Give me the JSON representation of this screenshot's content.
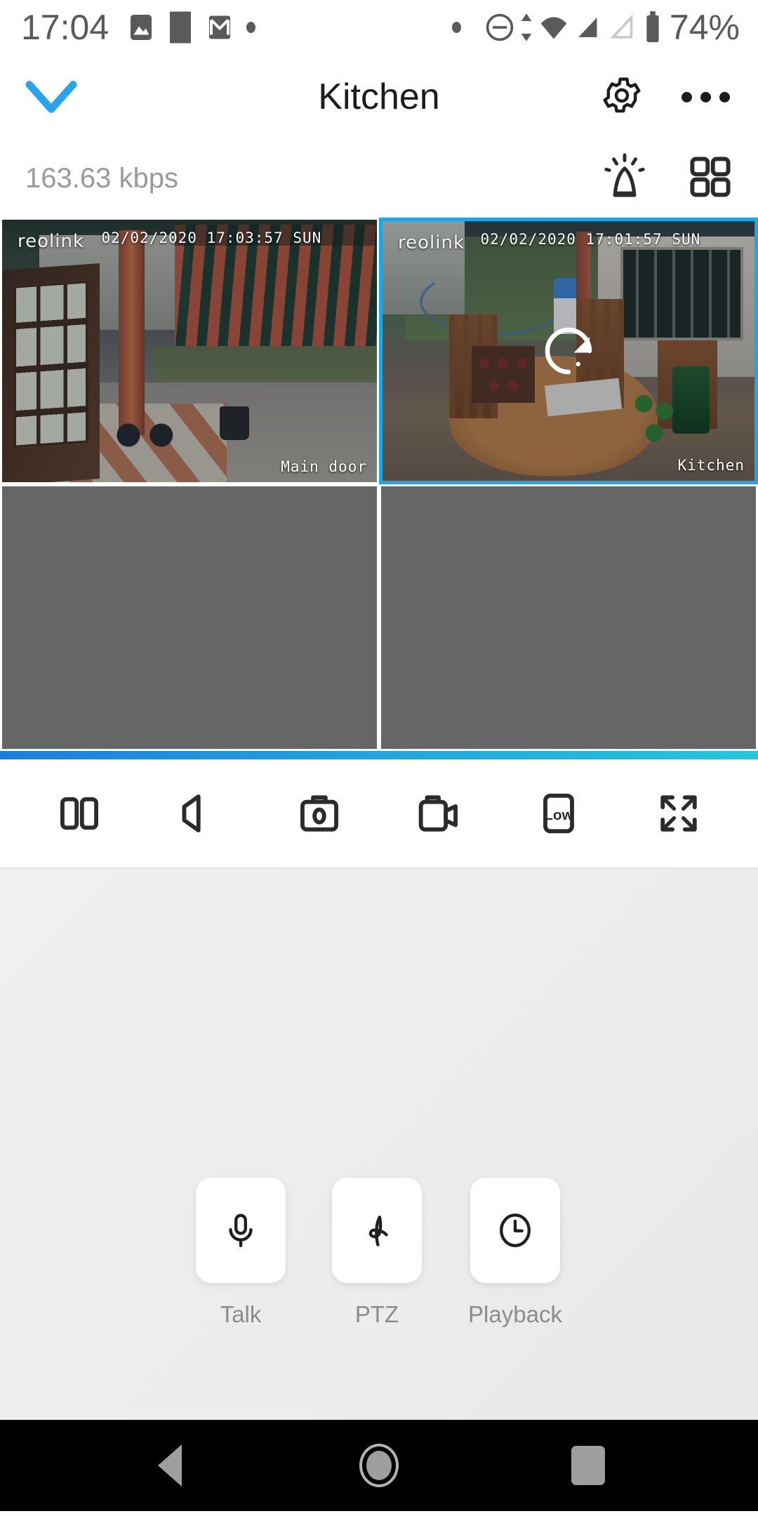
{
  "status_bar": {
    "clock": "17:04",
    "battery_percent": "74%",
    "icons": [
      "image-icon",
      "square-app-icon",
      "gmail-icon",
      "dot-icon",
      "dot-icon",
      "do-not-disturb-icon",
      "wifi-icon",
      "signal-no-sim-icon",
      "signal-empty-icon",
      "battery-icon"
    ]
  },
  "header": {
    "title": "Kitchen",
    "back_icon": "chevron-down-icon",
    "settings_icon": "gear-icon",
    "overflow_icon": "more-options-icon",
    "accent_color": "#1b9ae8"
  },
  "info_bar": {
    "bitrate": "163.63 kbps",
    "siren_icon": "siren-alarm-icon",
    "layout_icon": "grid-layout-icon"
  },
  "video_grid": {
    "brand": "reolink",
    "cells": [
      {
        "name": "Main door",
        "timestamp": "02/02/2020 17:03:57 SUN",
        "state": "live",
        "selected": false,
        "loading": false
      },
      {
        "name": "Kitchen",
        "timestamp": "02/02/2020 17:01:57 SUN",
        "state": "live",
        "selected": true,
        "loading": true
      },
      {
        "name": "",
        "timestamp": "",
        "state": "empty",
        "selected": false,
        "loading": false
      },
      {
        "name": "",
        "timestamp": "",
        "state": "empty",
        "selected": false,
        "loading": false
      }
    ],
    "selection_color": "#18a8e8",
    "empty_color": "#666666"
  },
  "toolbar": {
    "items": [
      {
        "label": "",
        "icon": "pause-icon"
      },
      {
        "label": "",
        "icon": "speaker-mute-icon"
      },
      {
        "label": "",
        "icon": "snapshot-camera-icon"
      },
      {
        "label": "",
        "icon": "video-record-icon"
      },
      {
        "label": "Low",
        "icon": "stream-quality-icon"
      },
      {
        "label": "",
        "icon": "fullscreen-expand-icon"
      }
    ],
    "quality_value": "Low"
  },
  "actions": [
    {
      "label": "Talk",
      "icon": "microphone-icon"
    },
    {
      "label": "PTZ",
      "icon": "ptz-swirl-icon"
    },
    {
      "label": "Playback",
      "icon": "clock-icon"
    }
  ],
  "nav_bar": {
    "back": "back-triangle-icon",
    "home": "home-circle-icon",
    "recents": "recents-square-icon"
  }
}
